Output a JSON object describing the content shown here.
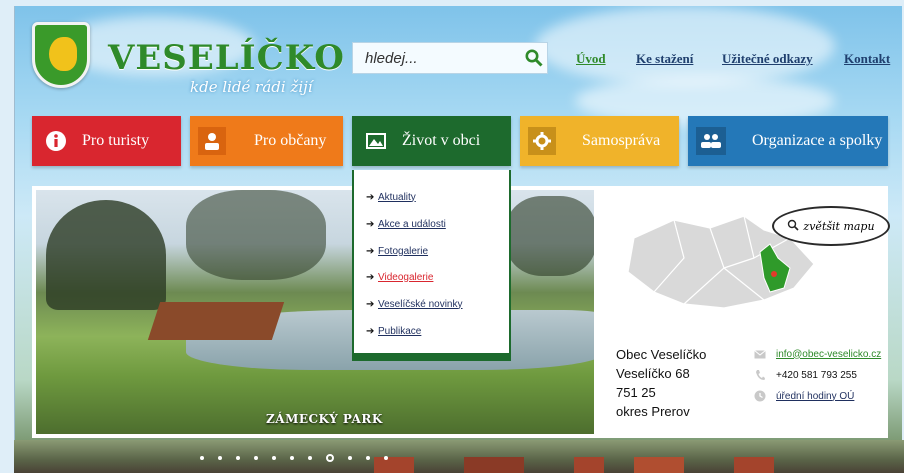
{
  "brand": {
    "title": "VESELÍČKO",
    "motto": "kde lidé rádi žijí"
  },
  "search": {
    "placeholder": "hledej..."
  },
  "topnav": [
    {
      "label": "Úvod"
    },
    {
      "label": "Ke stažení"
    },
    {
      "label": "Užitečné odkazy"
    },
    {
      "label": "Kontakt"
    }
  ],
  "menu": [
    {
      "label": "Pro turisty",
      "icon": "info-icon",
      "color": "#d9262f"
    },
    {
      "label": "Pro občany",
      "icon": "person-icon",
      "color": "#ef7a1a"
    },
    {
      "label": "Život v obci",
      "icon": "picture-icon",
      "color": "#1d6a2d"
    },
    {
      "label": "Samospráva",
      "icon": "gear-icon",
      "color": "#f0b32a"
    },
    {
      "label": "Organizace a spolky",
      "icon": "people-icon",
      "color": "#2478b8"
    }
  ],
  "dropdown": [
    {
      "label": "Aktuality"
    },
    {
      "label": "Akce a události"
    },
    {
      "label": "Fotogalerie"
    },
    {
      "label": "Videogalerie",
      "active": true
    },
    {
      "label": "Veselíčské novinky"
    },
    {
      "label": "Publikace"
    }
  ],
  "photo": {
    "caption": "ZÁMECKÝ PARK"
  },
  "map": {
    "bubble_label": "zvětšit mapu"
  },
  "contact": {
    "name": "Obec Veselíčko",
    "street": "Veselíčko 68",
    "zip": "751 25",
    "district": "okres Prerov",
    "email": "info@obec-veselicko.cz",
    "phone": "+420 581 793 255",
    "hours_link": "úřední hodiny OÚ"
  },
  "slider": {
    "active_index": 7,
    "count": 11
  }
}
